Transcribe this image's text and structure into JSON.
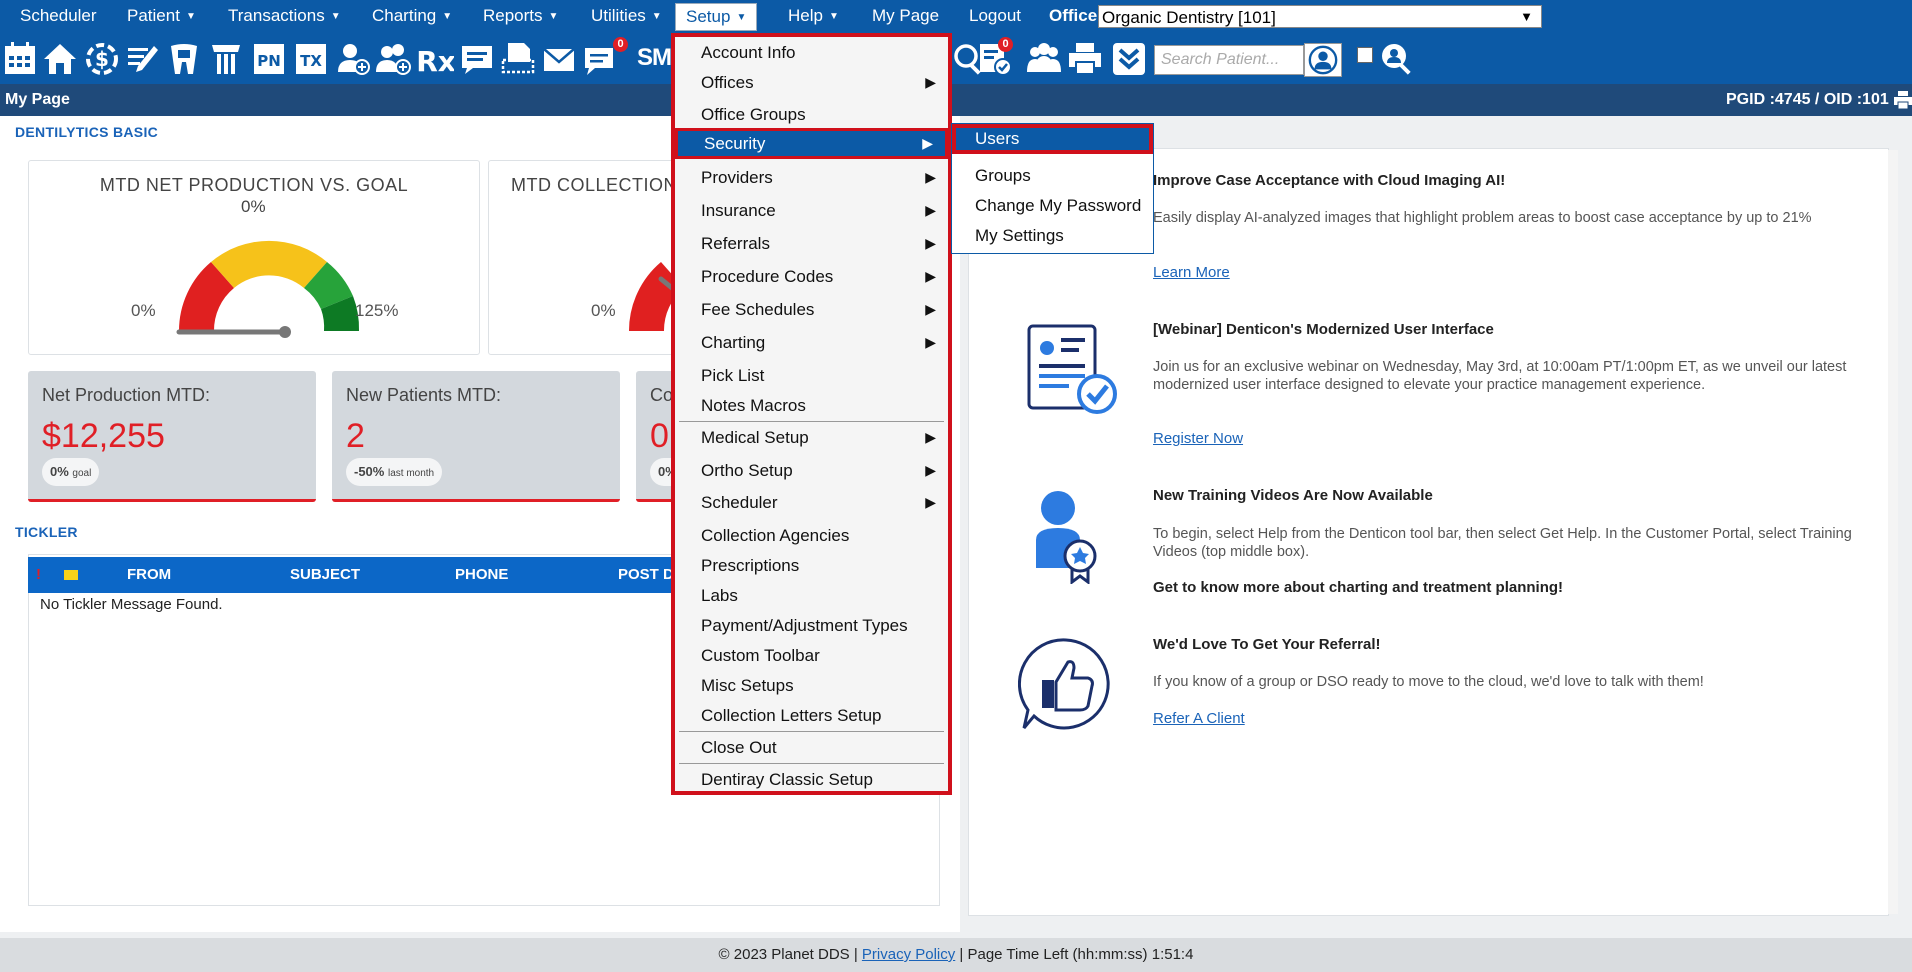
{
  "menubar": {
    "items": [
      "Scheduler",
      "Patient",
      "Transactions",
      "Charting",
      "Reports",
      "Utilities",
      "Setup",
      "Help",
      "My Page",
      "Logout"
    ],
    "office_label": "Office",
    "office_value": "Organic Dentistry [101]"
  },
  "toolbar": {
    "icons": [
      "calendar-icon",
      "home-icon",
      "dollar-icon",
      "pencil-icon",
      "tooth-icon",
      "implant-icon",
      "pn-icon",
      "tx-icon",
      "add-patient-icon",
      "add-family-icon",
      "rx-icon",
      "note-icon",
      "print-icon",
      "envelope-icon",
      "message-icon",
      "sms-icon"
    ],
    "pn_text": "PN",
    "tx_text": "TX",
    "rx_text": "Rx",
    "sms_text": "SMS",
    "message_badge": "0",
    "form_badge": "0",
    "search_placeholder": "Search Patient..."
  },
  "titlebar": {
    "title": "My Page",
    "ids": "PGID :4745  /  OID :101"
  },
  "dashboard": {
    "section_label": "DENTILYTICS BASIC",
    "gauge1": {
      "title": "MTD NET PRODUCTION VS. GOAL",
      "value": "0%",
      "min": "0%",
      "max": "125%"
    },
    "gauge2": {
      "title": "MTD COLLECTION",
      "min": "0%"
    },
    "kpis": [
      {
        "label": "Net Production MTD:",
        "value": "$12,255",
        "pill_main": "0%",
        "pill_sub": "goal"
      },
      {
        "label": "New Patients MTD:",
        "value": "2",
        "pill_main": "-50%",
        "pill_sub": "last month"
      },
      {
        "label": "Co",
        "value": "0",
        "pill_main": "0%",
        "pill_sub": ""
      }
    ]
  },
  "tickler": {
    "section_label": "TICKLER",
    "columns": [
      "!",
      "FROM",
      "SUBJECT",
      "PHONE",
      "POST D"
    ],
    "empty_text": "No Tickler Message Found."
  },
  "news": [
    {
      "title": "Improve Case Acceptance with Cloud Imaging AI!",
      "body": "Easily display AI-analyzed images that highlight problem areas to boost case acceptance by up to 21%",
      "link": "Learn More"
    },
    {
      "title": "[Webinar] Denticon's Modernized User Interface",
      "body": "Join us for an exclusive webinar on Wednesday, May 3rd, at 10:00am PT/1:00pm ET, as we unveil our latest modernized user interface designed to elevate your practice management experience.",
      "link": "Register Now"
    },
    {
      "title": "New Training Videos Are Now Available",
      "body": "To begin, select Help from the Denticon tool bar, then select Get Help. In the Customer Portal, select Training Videos (top middle box).",
      "extra": "Get to know more about charting and treatment planning!"
    },
    {
      "title": "We'd Love To Get Your Referral!",
      "body": "If you know of a group or DSO ready to move to the cloud, we'd love to talk with them!",
      "link": "Refer A Client"
    }
  ],
  "setup_menu": {
    "items": [
      {
        "label": "Account Info",
        "sub": false
      },
      {
        "label": "Offices",
        "sub": true
      },
      {
        "label": "Office Groups",
        "sub": false
      },
      {
        "label": "Security",
        "sub": true
      },
      {
        "label": "Providers",
        "sub": true
      },
      {
        "label": "Insurance",
        "sub": true
      },
      {
        "label": "Referrals",
        "sub": true
      },
      {
        "label": "Procedure Codes",
        "sub": true
      },
      {
        "label": "Fee Schedules",
        "sub": true
      },
      {
        "label": "Charting",
        "sub": true
      },
      {
        "label": "Pick List",
        "sub": false
      },
      {
        "label": "Notes Macros",
        "sub": false
      },
      {
        "label": "Medical Setup",
        "sub": true
      },
      {
        "label": "Ortho Setup",
        "sub": true
      },
      {
        "label": "Scheduler",
        "sub": true
      },
      {
        "label": "Collection Agencies",
        "sub": false
      },
      {
        "label": "Prescriptions",
        "sub": false
      },
      {
        "label": "Labs",
        "sub": false
      },
      {
        "label": "Payment/Adjustment Types",
        "sub": false
      },
      {
        "label": "Custom Toolbar",
        "sub": false
      },
      {
        "label": "Misc Setups",
        "sub": false
      },
      {
        "label": "Collection Letters Setup",
        "sub": false
      },
      {
        "label": "Close Out",
        "sub": false
      },
      {
        "label": "Dentiray Classic Setup",
        "sub": false
      }
    ]
  },
  "security_menu": {
    "items": [
      "Users",
      "Groups",
      "Change My Password",
      "My Settings"
    ]
  },
  "footer": {
    "copyright": "© 2023 Planet DDS | ",
    "privacy": "Privacy Policy",
    "time_left": " |  Page Time Left (hh:mm:ss) 1:51:4"
  },
  "colors": {
    "brand_blue": "#0c5aa6",
    "highlight_red": "#d0101b",
    "kpi_red": "#e01f26"
  }
}
